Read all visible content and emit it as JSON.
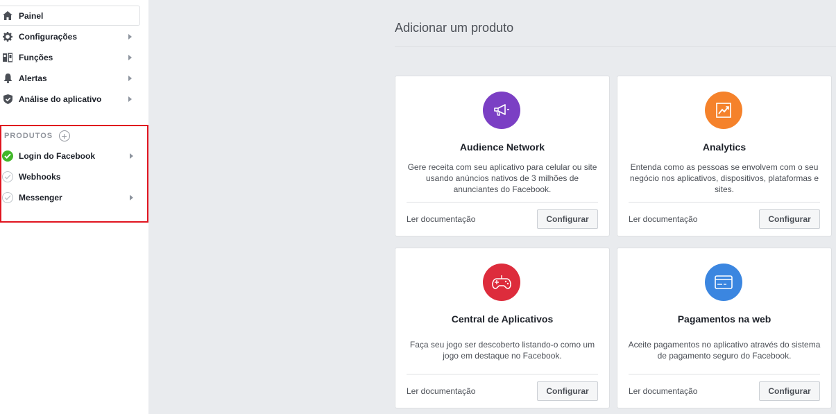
{
  "sidebar": {
    "items": [
      {
        "label": "Painel",
        "icon": "home-icon"
      },
      {
        "label": "Configurações",
        "icon": "gear-icon"
      },
      {
        "label": "Funções",
        "icon": "roles-icon"
      },
      {
        "label": "Alertas",
        "icon": "bell-icon"
      },
      {
        "label": "Análise do aplicativo",
        "icon": "shield-icon"
      }
    ],
    "products_header": "PRODUTOS",
    "products": [
      {
        "label": "Login do Facebook",
        "status": "active"
      },
      {
        "label": "Webhooks",
        "status": "inactive"
      },
      {
        "label": "Messenger",
        "status": "inactive"
      }
    ]
  },
  "main": {
    "title": "Adicionar um produto",
    "cards": [
      {
        "title": "Audience Network",
        "description": "Gere receita com seu aplicativo para celular ou site usando anúncios nativos de 3 milhões de anunciantes do Facebook.",
        "doc_link": "Ler documentação",
        "button": "Configurar",
        "icon": "megaphone-icon",
        "color": "#7b3fc4"
      },
      {
        "title": "Analytics",
        "description": "Entenda como as pessoas se envolvem com o seu negócio nos aplicativos, dispositivos, plataformas e sites.",
        "doc_link": "Ler documentação",
        "button": "Configurar",
        "icon": "chart-icon",
        "color": "#f5822b"
      },
      {
        "title": "Central de Aplicativos",
        "description": "Faça seu jogo ser descoberto listando-o como um jogo em destaque no Facebook.",
        "doc_link": "Ler documentação",
        "button": "Configurar",
        "icon": "gamepad-icon",
        "color": "#dd2c3c"
      },
      {
        "title": "Pagamentos na web",
        "description": "Aceite pagamentos no aplicativo através do sistema de pagamento seguro do Facebook.",
        "doc_link": "Ler documentação",
        "button": "Configurar",
        "icon": "credit-card-icon",
        "color": "#3b86e0"
      }
    ]
  },
  "colors": {
    "highlight_border": "#e0141f",
    "active_status": "#42b72a",
    "background": "#e9ebee"
  }
}
